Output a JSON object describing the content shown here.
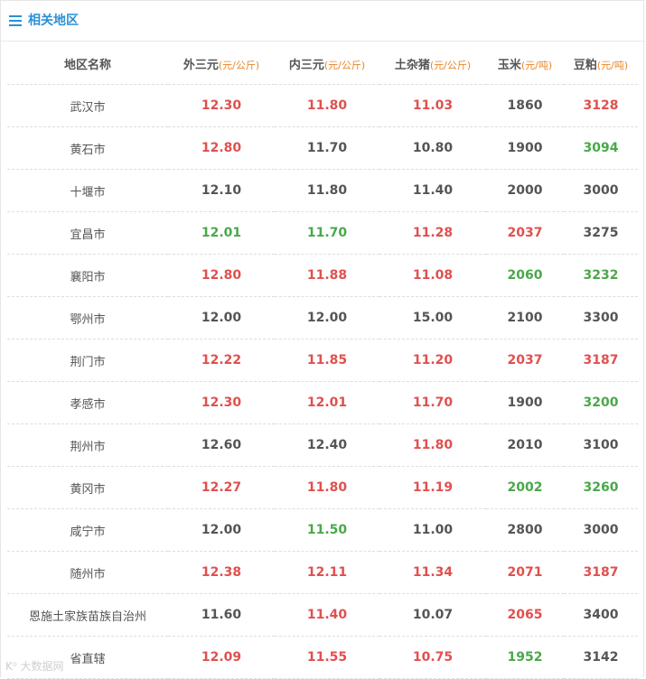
{
  "header": {
    "title": "相关地区",
    "icon": "menu-icon",
    "accent_color": "#2a8fd6"
  },
  "colors": {
    "up": "#e0504e",
    "down": "#4aa84a",
    "flat": "#555555",
    "unit": "#e8862a"
  },
  "table": {
    "columns": [
      {
        "label": "地区名称",
        "unit": ""
      },
      {
        "label": "外三元",
        "unit": "(元/公斤)"
      },
      {
        "label": "内三元",
        "unit": "(元/公斤)"
      },
      {
        "label": "土杂猪",
        "unit": "(元/公斤)"
      },
      {
        "label": "玉米",
        "unit": "(元/吨)"
      },
      {
        "label": "豆粕",
        "unit": "(元/吨)"
      }
    ],
    "rows": [
      {
        "region": "武汉市",
        "cells": [
          {
            "value": "12.30",
            "trend": "red"
          },
          {
            "value": "11.80",
            "trend": "red"
          },
          {
            "value": "11.03",
            "trend": "red"
          },
          {
            "value": "1860",
            "trend": "gray"
          },
          {
            "value": "3128",
            "trend": "red"
          }
        ]
      },
      {
        "region": "黄石市",
        "cells": [
          {
            "value": "12.80",
            "trend": "red"
          },
          {
            "value": "11.70",
            "trend": "gray"
          },
          {
            "value": "10.80",
            "trend": "gray"
          },
          {
            "value": "1900",
            "trend": "gray"
          },
          {
            "value": "3094",
            "trend": "green"
          }
        ]
      },
      {
        "region": "十堰市",
        "cells": [
          {
            "value": "12.10",
            "trend": "gray"
          },
          {
            "value": "11.80",
            "trend": "gray"
          },
          {
            "value": "11.40",
            "trend": "gray"
          },
          {
            "value": "2000",
            "trend": "gray"
          },
          {
            "value": "3000",
            "trend": "gray"
          }
        ]
      },
      {
        "region": "宜昌市",
        "cells": [
          {
            "value": "12.01",
            "trend": "green"
          },
          {
            "value": "11.70",
            "trend": "green"
          },
          {
            "value": "11.28",
            "trend": "red"
          },
          {
            "value": "2037",
            "trend": "red"
          },
          {
            "value": "3275",
            "trend": "gray"
          }
        ]
      },
      {
        "region": "襄阳市",
        "cells": [
          {
            "value": "12.80",
            "trend": "red"
          },
          {
            "value": "11.88",
            "trend": "red"
          },
          {
            "value": "11.08",
            "trend": "red"
          },
          {
            "value": "2060",
            "trend": "green"
          },
          {
            "value": "3232",
            "trend": "green"
          }
        ]
      },
      {
        "region": "鄂州市",
        "cells": [
          {
            "value": "12.00",
            "trend": "gray"
          },
          {
            "value": "12.00",
            "trend": "gray"
          },
          {
            "value": "15.00",
            "trend": "gray"
          },
          {
            "value": "2100",
            "trend": "gray"
          },
          {
            "value": "3300",
            "trend": "gray"
          }
        ]
      },
      {
        "region": "荆门市",
        "cells": [
          {
            "value": "12.22",
            "trend": "red"
          },
          {
            "value": "11.85",
            "trend": "red"
          },
          {
            "value": "11.20",
            "trend": "red"
          },
          {
            "value": "2037",
            "trend": "red"
          },
          {
            "value": "3187",
            "trend": "red"
          }
        ]
      },
      {
        "region": "孝感市",
        "cells": [
          {
            "value": "12.30",
            "trend": "red"
          },
          {
            "value": "12.01",
            "trend": "red"
          },
          {
            "value": "11.70",
            "trend": "red"
          },
          {
            "value": "1900",
            "trend": "gray"
          },
          {
            "value": "3200",
            "trend": "green"
          }
        ]
      },
      {
        "region": "荆州市",
        "cells": [
          {
            "value": "12.60",
            "trend": "gray"
          },
          {
            "value": "12.40",
            "trend": "gray"
          },
          {
            "value": "11.80",
            "trend": "red"
          },
          {
            "value": "2010",
            "trend": "gray"
          },
          {
            "value": "3100",
            "trend": "gray"
          }
        ]
      },
      {
        "region": "黄冈市",
        "cells": [
          {
            "value": "12.27",
            "trend": "red"
          },
          {
            "value": "11.80",
            "trend": "red"
          },
          {
            "value": "11.19",
            "trend": "red"
          },
          {
            "value": "2002",
            "trend": "green"
          },
          {
            "value": "3260",
            "trend": "green"
          }
        ]
      },
      {
        "region": "咸宁市",
        "cells": [
          {
            "value": "12.00",
            "trend": "gray"
          },
          {
            "value": "11.50",
            "trend": "green"
          },
          {
            "value": "11.00",
            "trend": "gray"
          },
          {
            "value": "2800",
            "trend": "gray"
          },
          {
            "value": "3000",
            "trend": "gray"
          }
        ]
      },
      {
        "region": "随州市",
        "cells": [
          {
            "value": "12.38",
            "trend": "red"
          },
          {
            "value": "12.11",
            "trend": "red"
          },
          {
            "value": "11.34",
            "trend": "red"
          },
          {
            "value": "2071",
            "trend": "red"
          },
          {
            "value": "3187",
            "trend": "red"
          }
        ]
      },
      {
        "region": "恩施土家族苗族自治州",
        "cells": [
          {
            "value": "11.60",
            "trend": "gray"
          },
          {
            "value": "11.40",
            "trend": "red"
          },
          {
            "value": "10.07",
            "trend": "gray"
          },
          {
            "value": "2065",
            "trend": "red"
          },
          {
            "value": "3400",
            "trend": "gray"
          }
        ]
      },
      {
        "region": "省直辖",
        "cells": [
          {
            "value": "12.09",
            "trend": "red"
          },
          {
            "value": "11.55",
            "trend": "red"
          },
          {
            "value": "10.75",
            "trend": "red"
          },
          {
            "value": "1952",
            "trend": "green"
          },
          {
            "value": "3142",
            "trend": "gray"
          }
        ]
      }
    ]
  },
  "watermark": {
    "text": "K⁰ 大数据网"
  }
}
